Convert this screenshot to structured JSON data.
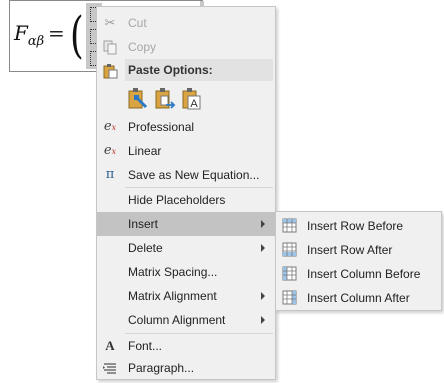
{
  "equation": {
    "symbol": "F",
    "subscript": "αβ",
    "equals": "=",
    "open_paren": "("
  },
  "context_menu": {
    "cut": "Cut",
    "copy": "Copy",
    "paste_options": "Paste Options:",
    "professional": "Professional",
    "linear": "Linear",
    "save_as_new_equation": "Save as New Equation...",
    "hide_placeholders": "Hide Placeholders",
    "insert": "Insert",
    "delete": "Delete",
    "matrix_spacing": "Matrix Spacing...",
    "matrix_alignment": "Matrix Alignment",
    "column_alignment": "Column Alignment",
    "font": "Font...",
    "paragraph": "Paragraph..."
  },
  "insert_submenu": {
    "insert_row_before": "Insert Row Before",
    "insert_row_after": "Insert Row After",
    "insert_column_before": "Insert Column Before",
    "insert_column_after": "Insert Column After"
  },
  "colors": {
    "menu_bg": "#f0f0f0",
    "hover_bg": "#c3c3c3",
    "disabled_text": "#a6a6a6",
    "accent_blue": "#2b78c5",
    "accent_orange": "#d98a1a"
  },
  "icons": {
    "cut": "scissors-icon",
    "copy": "copy-icon",
    "paste": "paste-icon",
    "professional": "professional-equation-icon",
    "linear": "linear-equation-icon",
    "save_equation": "pi-equation-icon",
    "font": "font-icon",
    "paragraph": "paragraph-icon"
  }
}
